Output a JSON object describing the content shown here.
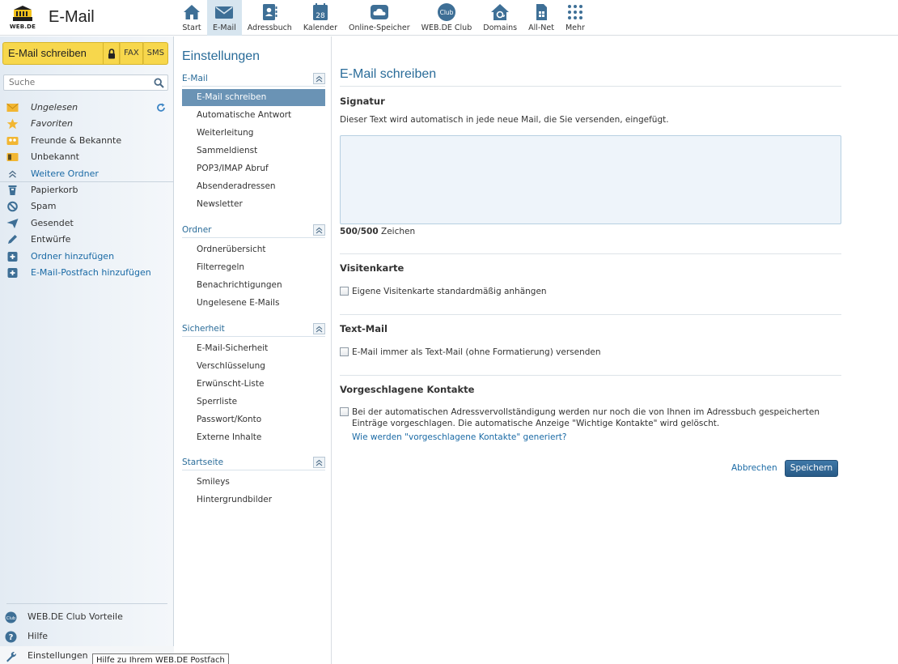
{
  "header": {
    "logo_text": "WEB.DE",
    "app_title": "E-Mail",
    "nav": [
      {
        "label": "Start",
        "icon": "home-icon"
      },
      {
        "label": "E-Mail",
        "icon": "envelope-icon",
        "active": true
      },
      {
        "label": "Adressbuch",
        "icon": "address-book-icon"
      },
      {
        "label": "Kalender",
        "icon": "calendar-icon",
        "day": "28"
      },
      {
        "label": "Online-Speicher",
        "icon": "cloud-icon"
      },
      {
        "label": "WEB.DE Club",
        "icon": "club-icon",
        "badge": "Club"
      },
      {
        "label": "Domains",
        "icon": "domains-icon"
      },
      {
        "label": "All-Net",
        "icon": "sim-card-icon"
      },
      {
        "label": "Mehr",
        "icon": "grid-icon"
      }
    ]
  },
  "sidebar": {
    "compose_label": "E-Mail schreiben",
    "fax_label": "FAX",
    "sms_label": "SMS",
    "search_placeholder": "Suche",
    "folders": [
      {
        "label": "Ungelesen",
        "icon": "envelope-icon"
      },
      {
        "label": "Favoriten",
        "icon": "star-icon"
      },
      {
        "label": "Freunde & Bekannte",
        "icon": "friends-icon"
      },
      {
        "label": "Unbekannt",
        "icon": "unknown-icon"
      },
      {
        "label": "Weitere Ordner",
        "icon": "chevron-up-icon"
      },
      {
        "label": "Papierkorb",
        "icon": "trash-icon"
      },
      {
        "label": "Spam",
        "icon": "spam-icon"
      },
      {
        "label": "Gesendet",
        "icon": "sent-icon"
      },
      {
        "label": "Entwürfe",
        "icon": "pencil-icon"
      },
      {
        "label": "Ordner hinzufügen",
        "icon": "plus-icon"
      },
      {
        "label": "E-Mail-Postfach hinzufügen",
        "icon": "plus-icon"
      }
    ],
    "bottom_links": [
      {
        "label": "WEB.DE Club Vorteile",
        "icon": "club-icon",
        "badge": "Club"
      },
      {
        "label": "Hilfe",
        "icon": "help-icon",
        "badge": "?"
      },
      {
        "label": "Einstellungen",
        "icon": "wrench-icon"
      }
    ],
    "tooltip": "Hilfe zu Ihrem WEB.DE Postfach"
  },
  "settings_nav": {
    "title": "Einstellungen",
    "groups": [
      {
        "label": "E-Mail",
        "items": [
          "E-Mail schreiben",
          "Automatische Antwort",
          "Weiterleitung",
          "Sammeldienst",
          "POP3/IMAP Abruf",
          "Absenderadressen",
          "Newsletter"
        ]
      },
      {
        "label": "Ordner",
        "items": [
          "Ordnerübersicht",
          "Filterregeln",
          "Benachrichtigungen",
          "Ungelesene E-Mails"
        ]
      },
      {
        "label": "Sicherheit",
        "items": [
          "E-Mail-Sicherheit",
          "Verschlüsselung",
          "Erwünscht-Liste",
          "Sperrliste",
          "Passwort/Konto",
          "Externe Inhalte"
        ]
      },
      {
        "label": "Startseite",
        "items": [
          "Smileys",
          "Hintergrundbilder"
        ]
      }
    ]
  },
  "main": {
    "title": "E-Mail schreiben",
    "signature": {
      "heading": "Signatur",
      "description": "Dieser Text wird automatisch in jede neue Mail, die Sie versenden, eingefügt.",
      "value": "",
      "counter_value": "500/500",
      "counter_unit": "Zeichen"
    },
    "business_card": {
      "heading": "Visitenkarte",
      "checkbox_label": "Eigene Visitenkarte standardmäßig anhängen"
    },
    "text_mail": {
      "heading": "Text-Mail",
      "checkbox_label": "E-Mail immer als Text-Mail (ohne Formatierung) versenden"
    },
    "suggested_contacts": {
      "heading": "Vorgeschlagene Kontakte",
      "checkbox_label": "Bei der automatischen Adressvervollständigung werden nur noch die von Ihnen im Adressbuch gespeicherten Einträge vorgeschlagen. Die automatische Anzeige \"Wichtige Kontakte\" wird gelöscht.",
      "help_link": "Wie werden \"vorgeschlagene Kontakte\" generiert?"
    },
    "cancel_label": "Abbrechen",
    "save_label": "Speichern"
  },
  "colors": {
    "accent": "#2a6c99",
    "compose_yellow": "#f7d74c",
    "active_item": "#6a93b5",
    "save_button": "#2f6695"
  }
}
